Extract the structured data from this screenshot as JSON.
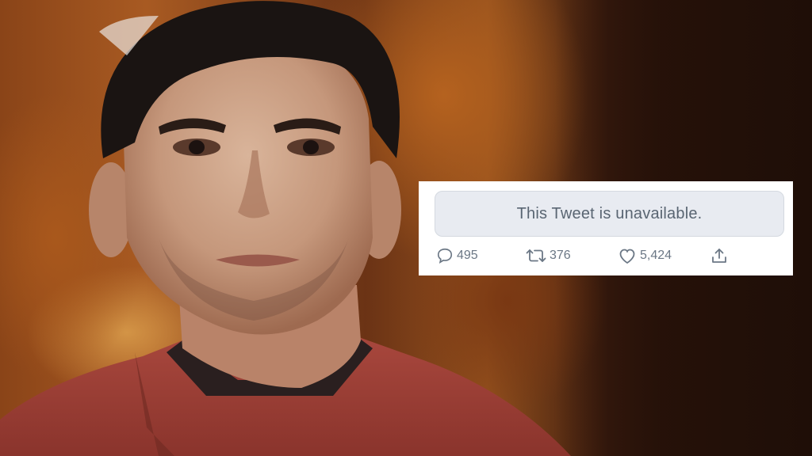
{
  "tweet": {
    "unavailable_text": "This Tweet is unavailable.",
    "actions": {
      "reply_count": "495",
      "retweet_count": "376",
      "like_count": "5,424"
    },
    "icons": {
      "reply": "reply-icon",
      "retweet": "retweet-icon",
      "like": "heart-icon",
      "share": "share-icon"
    },
    "colors": {
      "card_bg": "#ffffff",
      "unavailable_box_bg": "#e8ebf1",
      "text_muted": "#6b7785"
    }
  }
}
